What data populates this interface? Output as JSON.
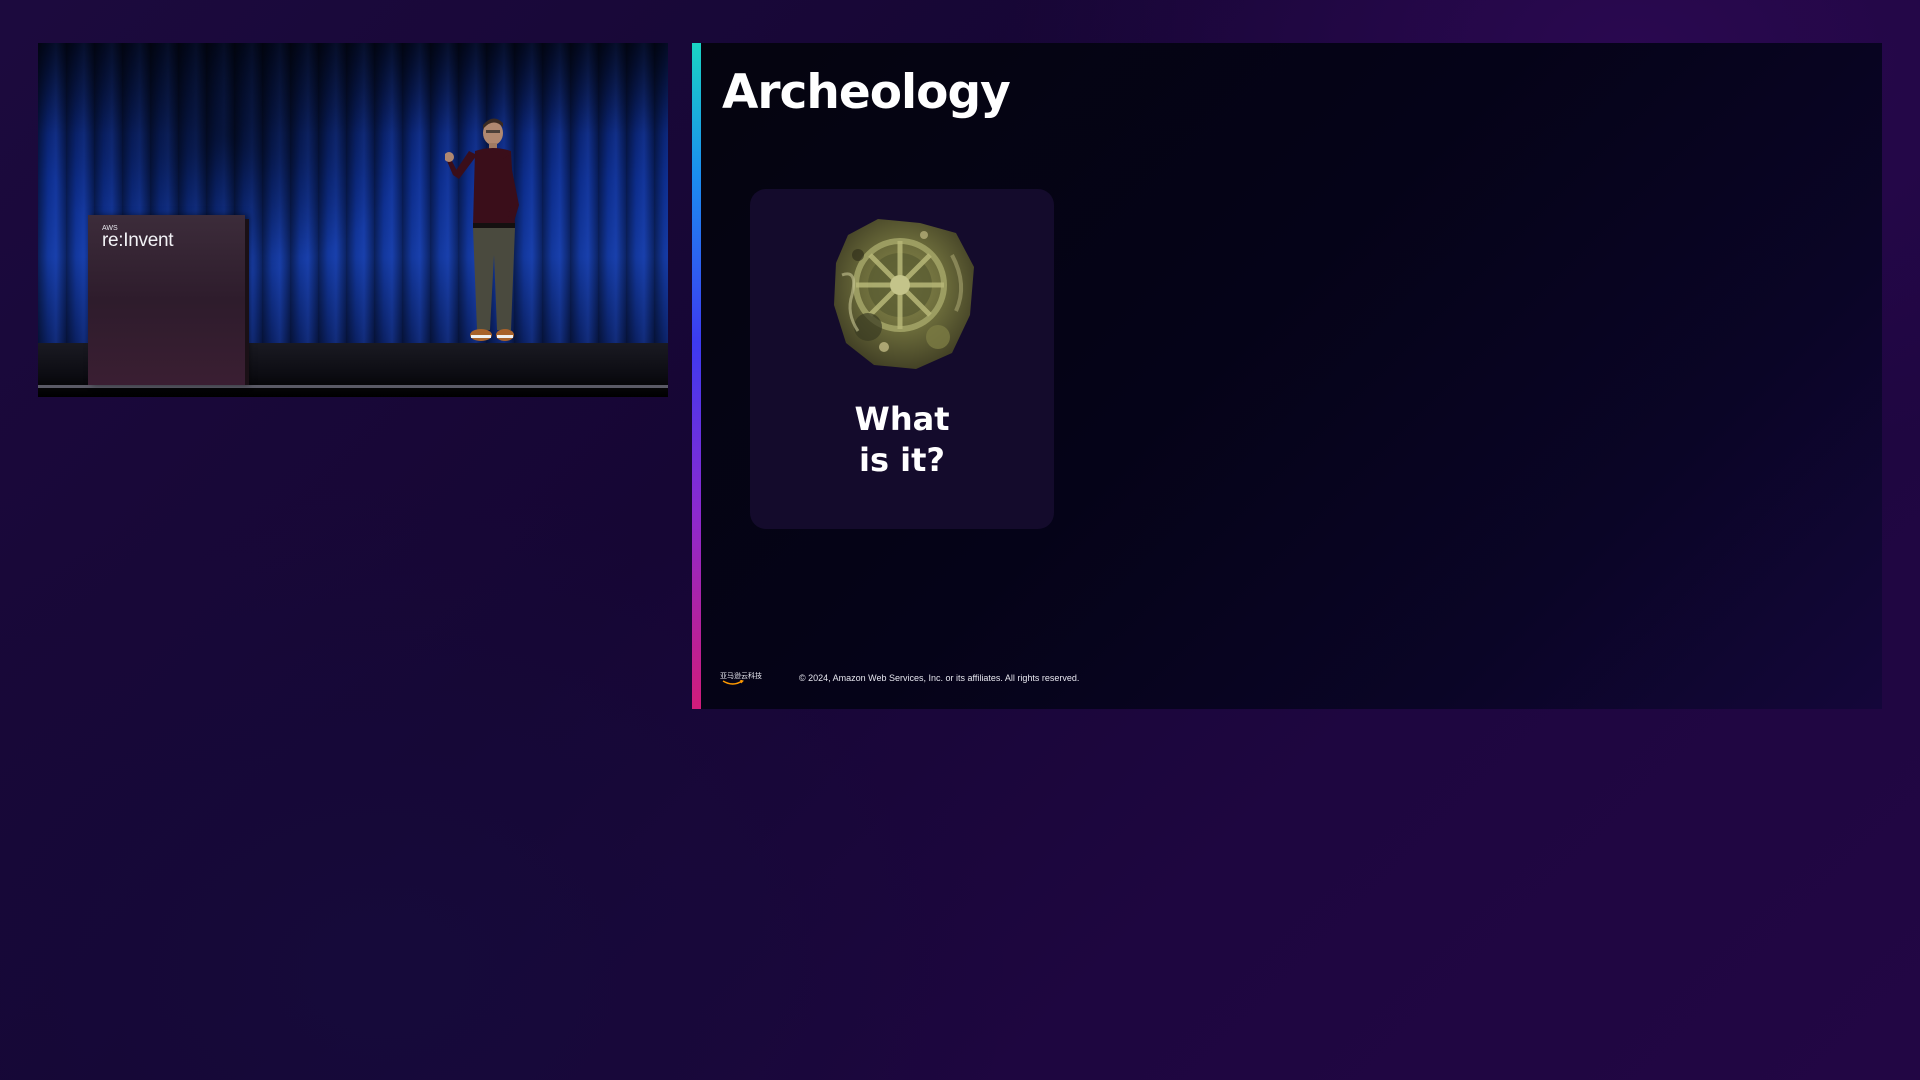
{
  "video": {
    "podium_brand_small": "AWS",
    "podium_brand": "re:Invent"
  },
  "slide": {
    "title": "Archeology",
    "card": {
      "caption_line1": "What",
      "caption_line2": "is it?",
      "image": "antikythera-mechanism"
    },
    "footer": {
      "logo_text": "亚马逊云科技",
      "copyright": "© 2024, Amazon Web Services, Inc. or its affiliates. All rights reserved."
    },
    "accent_gradient": [
      "#1ad3c4",
      "#1b8cf0",
      "#3d3af0",
      "#8a2ad0",
      "#d11c7a"
    ]
  },
  "colors": {
    "background": "#1c0a3e",
    "slide_background": "#05040f",
    "card_background": "#140b2c",
    "text": "#ffffff"
  }
}
